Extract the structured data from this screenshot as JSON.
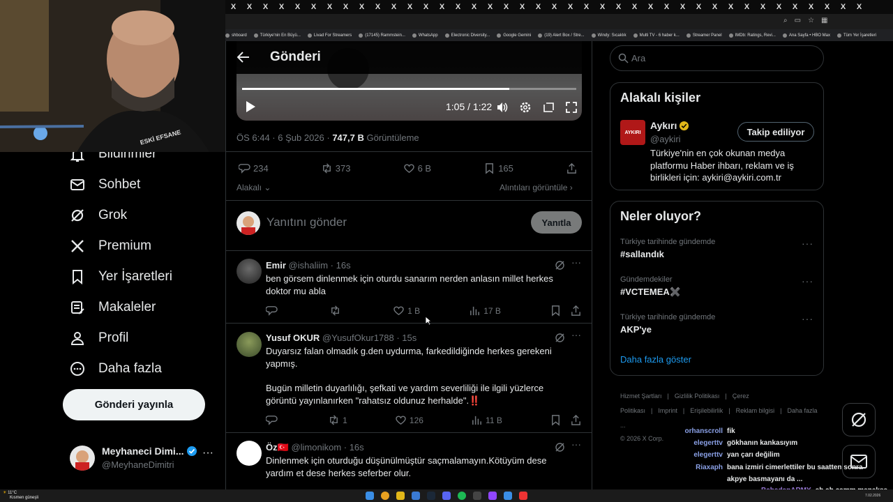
{
  "browser": {
    "tab_close_glyph": "X",
    "bookmarks": [
      "shboard",
      "Türkiye'nin En Büyü...",
      "Livad For Streamers",
      "(17145) Rammstein...",
      "WhatsApp",
      "Electronic Diversity...",
      "Google Gemini",
      "(19) Alert Box / Stre...",
      "Windy: Sıcaklık",
      "Multi TV - 6 haber k...",
      "Streamer Panel",
      "IMDb: Ratings, Revi...",
      "Ana Sayfa • HBO Max",
      "Tüm Yer İşaretleri"
    ]
  },
  "nav": {
    "items": [
      {
        "label": "Bildirimler",
        "icon": "bell-icon"
      },
      {
        "label": "Sohbet",
        "icon": "envelope-icon"
      },
      {
        "label": "Grok",
        "icon": "grok-icon"
      },
      {
        "label": "Premium",
        "icon": "x-logo-icon"
      },
      {
        "label": "Yer İşaretleri",
        "icon": "bookmark-icon"
      },
      {
        "label": "Makaleler",
        "icon": "article-icon"
      },
      {
        "label": "Profil",
        "icon": "person-icon"
      },
      {
        "label": "Daha fazla",
        "icon": "more-circle-icon"
      }
    ],
    "post_button": "Gönderi yayınla",
    "account": {
      "name": "Meyhaneci Dimi...",
      "handle": "@MeyhaneDimitri"
    }
  },
  "header": {
    "title": "Gönderi"
  },
  "video": {
    "time": "1:05 / 1:22",
    "progress": 0.8
  },
  "post": {
    "timestamp": "ÖS 6:44 · 6 Şub 2026 ·",
    "views": "747,7 B",
    "views_label": "Görüntüleme",
    "replies": "234",
    "reposts": "373",
    "likes": "6 B",
    "bookmarks": "165",
    "relevant_label": "Alakalı",
    "quotes_label": "Alıntıları görüntüle"
  },
  "composer": {
    "placeholder": "Yanıtını gönder",
    "button": "Yanıtla"
  },
  "replies": [
    {
      "name": "Emir",
      "handle": "@ishaliim · 16s",
      "text": "ben görsem dinlenmek için oturdu sanarım nerden anlasın millet herkes doktor mu abla",
      "reposts": "",
      "likes": "1 B",
      "views": "17 B"
    },
    {
      "name": "Yusuf OKUR",
      "handle": "@YusufOkur1788 · 15s",
      "text": "Duyarsız falan olmadık g.den uydurma, farkedildiğinde herkes gerekeni yapmış.",
      "text2": "Bugün milletin duyarlılığı, şefkati ve yardım severliliği ile ilgili yüzlerce görüntü yayınlanırken \"rahatsız oldunuz herhalde\".‼️",
      "reposts": "1",
      "likes": "126",
      "views": "11 B"
    },
    {
      "name": "Öz🇹🇷",
      "handle": "@limonikom · 16s",
      "text": "Dinlenmek için oturduğu düşünülmüştür saçmalamayın.Kötüyüm dese yardım et dese herkes seferber olur."
    }
  ],
  "right": {
    "search_placeholder": "Ara",
    "people_title": "Alakalı kişiler",
    "person": {
      "name": "Aykırı",
      "handle": "@aykiri",
      "bio": "Türkiye'nin en çok okunan medya platformu Haber ihbarı, reklam ve iş birlikleri için: aykiri@aykiri.com.tr",
      "follow_label": "Takip ediliyor",
      "logo_text": "AYKIRI"
    },
    "trends_title": "Neler oluyor?",
    "trends": [
      {
        "context": "Türkiye tarihinde gündemde",
        "name": "#sallandık"
      },
      {
        "context": "Gündemdekiler",
        "name": "#VCTEMEA✖️"
      },
      {
        "context": "Türkiye tarihinde gündemde",
        "name": "AKP'ye"
      }
    ],
    "show_more": "Daha fazla göster",
    "footer_links": [
      "Hizmet Şartları",
      "|",
      "Gizlilik Politikası",
      "|",
      "Çerez Politikası",
      "|",
      "Imprint",
      "|",
      "Erişilebilirlik",
      "|",
      "Reklam bilgisi",
      "|",
      "Daha fazla ..."
    ],
    "copyright": "© 2026 X Corp."
  },
  "chat": [
    {
      "user": "orhanscroll",
      "msg": "fik"
    },
    {
      "user": "elegerttv",
      "msg": "gökhanın kankasıyım"
    },
    {
      "user": "elegerttv",
      "msg": "yan çarı değilim"
    },
    {
      "user": "Riaxaph",
      "msg": "bana izmiri cimerlettiler bu saatten sonra"
    },
    {
      "user": "",
      "msg": "akpye basmayanı da ..."
    },
    {
      "user": "BabadanARMY",
      "msg": "ah ah çamm menekşe"
    }
  ],
  "webcam_overlay_text": "ESKİ EFSANE",
  "taskbar": {
    "weather": "11°C",
    "weather_desc": "Kısmen güneşli",
    "date": "7.02.2026"
  }
}
